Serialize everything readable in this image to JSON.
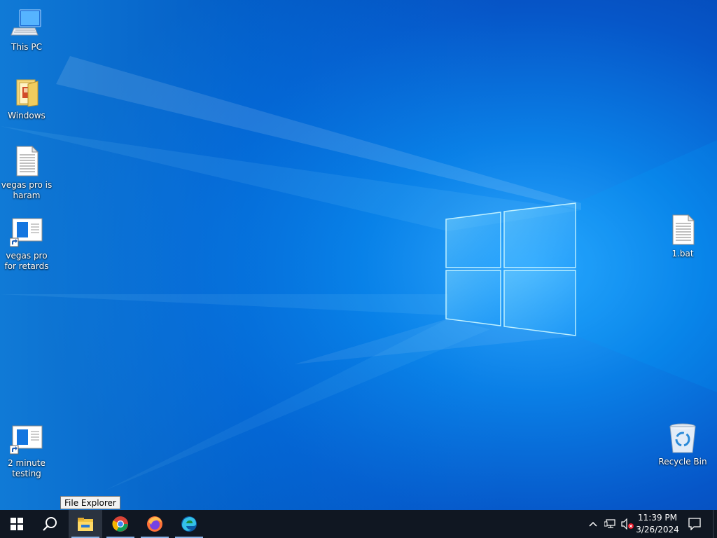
{
  "desktop": {
    "icons": [
      {
        "label": "This PC",
        "icon": "this-pc-icon"
      },
      {
        "label": "Windows",
        "icon": "folder-icon"
      },
      {
        "label": "vegas pro is haram",
        "icon": "text-file-icon"
      },
      {
        "label": "vegas pro for retards",
        "icon": "shortcut-app-icon"
      },
      {
        "label": "2 minute testing",
        "icon": "shortcut-app-icon"
      },
      {
        "label": "1.bat",
        "icon": "batch-file-icon"
      },
      {
        "label": "Recycle Bin",
        "icon": "recycle-bin-icon"
      }
    ]
  },
  "taskbar": {
    "start": "windows-start-icon",
    "search": "search-icon",
    "apps": [
      {
        "name": "File Explorer",
        "icon": "file-explorer-icon",
        "active": true
      },
      {
        "name": "Google Chrome",
        "icon": "chrome-icon",
        "active": false
      },
      {
        "name": "Firefox",
        "icon": "firefox-icon",
        "active": false
      },
      {
        "name": "Microsoft Edge",
        "icon": "edge-icon",
        "active": false
      }
    ],
    "tooltip": "File Explorer",
    "tray": {
      "time": "11:39 PM",
      "date": "3/26/2024"
    }
  },
  "colors": {
    "taskbar": "#101722",
    "desktop_accent": "#0a7fe6"
  }
}
